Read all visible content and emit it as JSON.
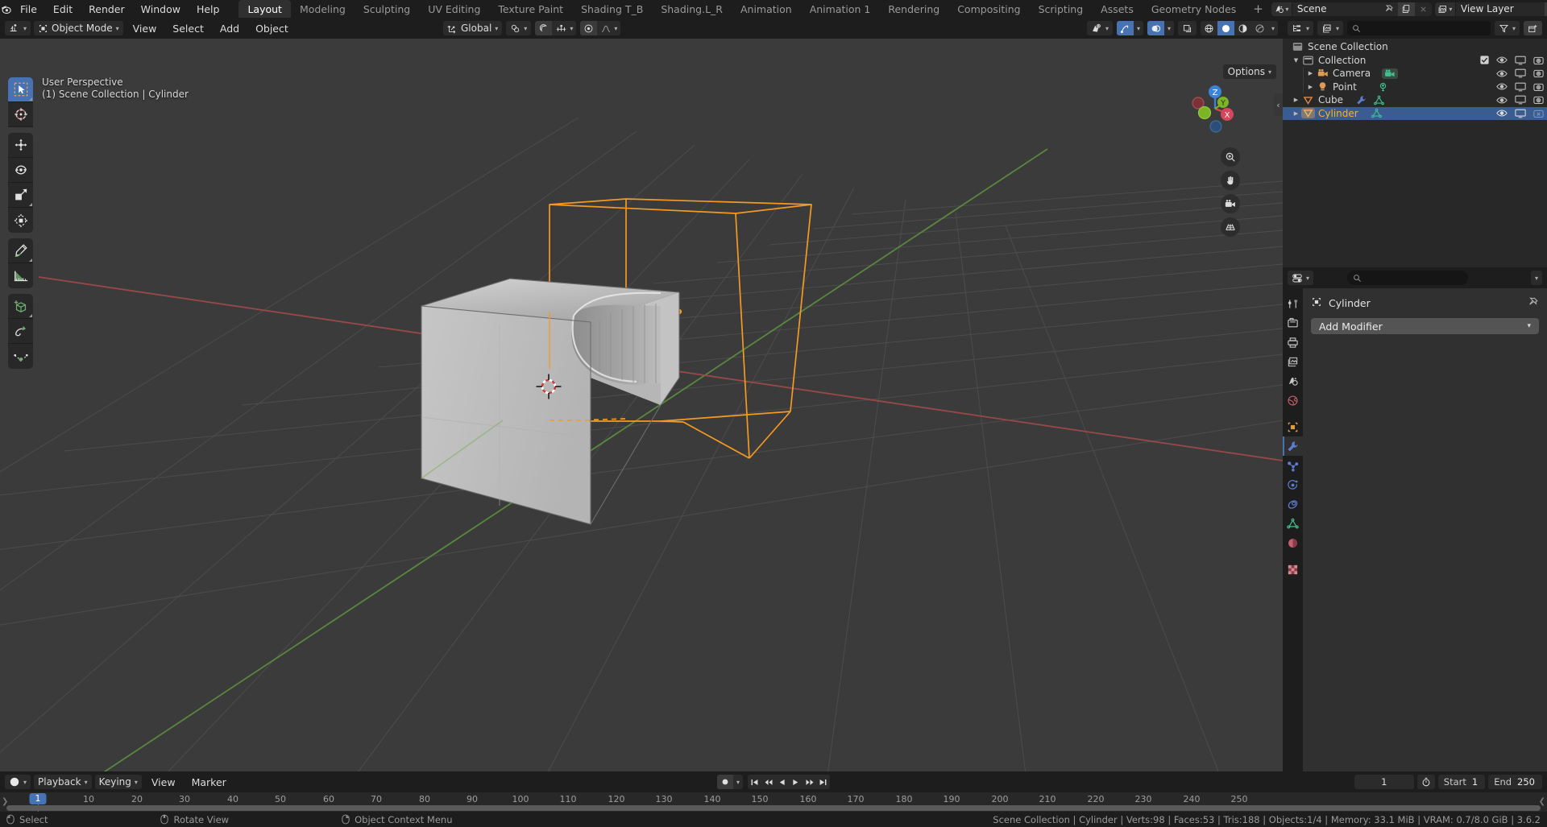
{
  "topbar": {
    "menus": [
      "File",
      "Edit",
      "Render",
      "Window",
      "Help"
    ],
    "workspaces": [
      {
        "label": "Layout",
        "active": true
      },
      {
        "label": "Modeling",
        "active": false
      },
      {
        "label": "Sculpting",
        "active": false
      },
      {
        "label": "UV Editing",
        "active": false
      },
      {
        "label": "Texture Paint",
        "active": false
      },
      {
        "label": "Shading T_B",
        "active": false
      },
      {
        "label": "Shading.L_R",
        "active": false
      },
      {
        "label": "Animation",
        "active": false
      },
      {
        "label": "Animation 1",
        "active": false
      },
      {
        "label": "Rendering",
        "active": false
      },
      {
        "label": "Compositing",
        "active": false
      },
      {
        "label": "Scripting",
        "active": false
      },
      {
        "label": "Assets",
        "active": false
      },
      {
        "label": "Geometry Nodes",
        "active": false
      }
    ],
    "add_workspace": "+",
    "scene_name": "Scene",
    "view_layer_name": "View Layer"
  },
  "viewport_header": {
    "mode": "Object Mode",
    "menus": [
      "View",
      "Select",
      "Add",
      "Object"
    ],
    "transform_orientation": "Global",
    "options_label": "Options"
  },
  "viewport": {
    "perspective_label": "User Perspective",
    "scene_label": "(1) Scene Collection | Cylinder",
    "gizmo_axes": [
      "X",
      "Y",
      "Z"
    ],
    "tools": [
      "tweak-select-tool",
      "cursor-tool",
      "move-tool",
      "rotate-tool",
      "scale-tool",
      "transform-tool",
      "annotate-tool",
      "measure-tool",
      "add-cube-tool",
      "extrude-region-tool",
      "spin-tool"
    ],
    "nav_buttons": [
      "zoom-icon",
      "hand-icon",
      "camera-icon",
      "grid-icon"
    ]
  },
  "outliner": {
    "rows": [
      {
        "label": "Scene Collection",
        "indent": 0,
        "icon": "collection-icon",
        "disclosure": "",
        "selected": false,
        "checkbox": false,
        "restrict": []
      },
      {
        "label": "Collection",
        "indent": 1,
        "icon": "collection-icon",
        "disclosure": "down",
        "selected": false,
        "checkbox": true,
        "restrict": [
          "eye",
          "screen",
          "camera"
        ]
      },
      {
        "label": "Camera",
        "indent": 2,
        "icon": "camera-object-icon",
        "disclosure": "right",
        "selected": false,
        "checkbox": false,
        "restrict": [
          "eye",
          "screen",
          "camera"
        ],
        "data_icon": "camera-data-icon"
      },
      {
        "label": "Point",
        "indent": 2,
        "icon": "light-object-icon",
        "disclosure": "right",
        "selected": false,
        "checkbox": false,
        "restrict": [
          "eye",
          "screen",
          "camera"
        ],
        "data_icon": "light-data-icon"
      },
      {
        "label": "Cube",
        "indent": 1,
        "icon": "mesh-object-icon",
        "disclosure": "right",
        "selected": false,
        "checkbox": false,
        "restrict": [
          "eye",
          "screen",
          "camera"
        ],
        "data_icon": "mesh-data-icon",
        "extra_icon": "wrench-modifier-icon"
      },
      {
        "label": "Cylinder",
        "indent": 1,
        "icon": "mesh-object-icon",
        "disclosure": "right",
        "selected": true,
        "checkbox": false,
        "restrict": [
          "eye",
          "screen",
          "camera-off"
        ],
        "data_icon": "mesh-data-icon"
      }
    ],
    "search_placeholder": ""
  },
  "properties": {
    "object_name": "Cylinder",
    "add_modifier_label": "Add Modifier",
    "search_placeholder": "",
    "tabs": [
      "tool-icon",
      "render-icon",
      "output-icon",
      "view-layer-icon",
      "scene-icon",
      "world-icon",
      "object-icon",
      "modifier-icon",
      "particles-icon",
      "physics-icon",
      "constraints-icon",
      "data-icon",
      "material-icon",
      "texture-icon"
    ],
    "active_tab": "modifier-icon"
  },
  "timeline": {
    "menus": [
      "Playback",
      "Keying",
      "View",
      "Marker"
    ],
    "current_frame": "1",
    "start_label": "Start",
    "start_value": "1",
    "end_label": "End",
    "end_value": "250",
    "ticks": [
      10,
      20,
      30,
      40,
      50,
      60,
      70,
      80,
      90,
      100,
      110,
      120,
      130,
      140,
      150,
      160,
      170,
      180,
      190,
      200,
      210,
      220,
      230,
      240,
      250
    ],
    "playhead_frame": 1
  },
  "statusbar": {
    "hints": [
      {
        "icon": "mouse-left-icon",
        "label": "Select"
      },
      {
        "icon": "mouse-middle-icon",
        "label": "Rotate View"
      },
      {
        "icon": "mouse-right-icon",
        "label": "Object Context Menu"
      }
    ],
    "stats": "Scene Collection | Cylinder | Verts:98 | Faces:53 | Tris:188 | Objects:1/4 | Memory: 33.1 MiB | VRAM: 0.7/8.0 GiB | 3.6.2"
  },
  "colors": {
    "accent_blue": "#4772b3",
    "selected_orange": "#ed9e41",
    "active_orange": "#ffaf29",
    "viewport_bg": "#3b3b3b",
    "panel_bg": "#303030",
    "header_bg": "#1d1d1d",
    "mesh_grey": "#b9b9b9"
  }
}
